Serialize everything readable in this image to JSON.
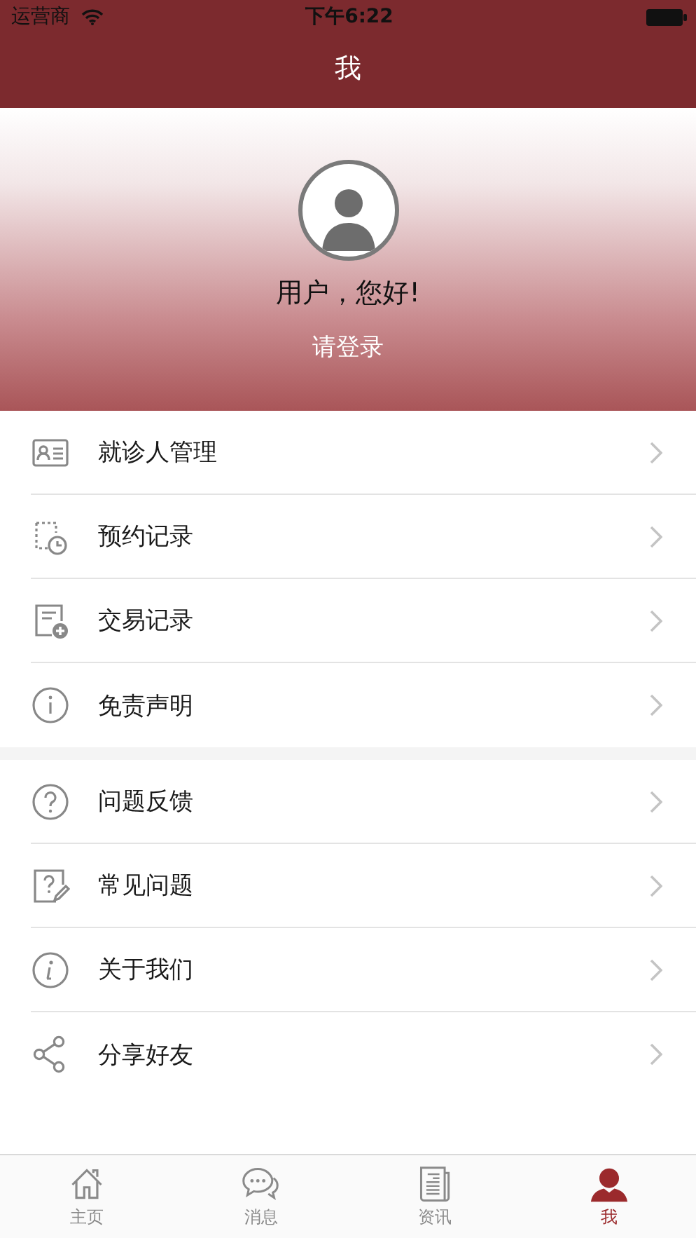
{
  "status_bar": {
    "carrier": "运营商",
    "time": "下午6:22"
  },
  "nav_bar": {
    "title": "我"
  },
  "profile": {
    "greeting": "用户，您好!",
    "login": "请登录"
  },
  "menu_groups": [
    {
      "items": [
        {
          "label": "就诊人管理"
        },
        {
          "label": "预约记录"
        },
        {
          "label": "交易记录"
        },
        {
          "label": "免责声明"
        }
      ]
    },
    {
      "items": [
        {
          "label": "问题反馈"
        },
        {
          "label": "常见问题"
        },
        {
          "label": "关于我们"
        },
        {
          "label": "分享好友"
        }
      ]
    }
  ],
  "tab_bar": [
    {
      "label": "主页",
      "selected": false
    },
    {
      "label": "消息",
      "selected": false
    },
    {
      "label": "资讯",
      "selected": false
    },
    {
      "label": "我",
      "selected": true
    }
  ]
}
